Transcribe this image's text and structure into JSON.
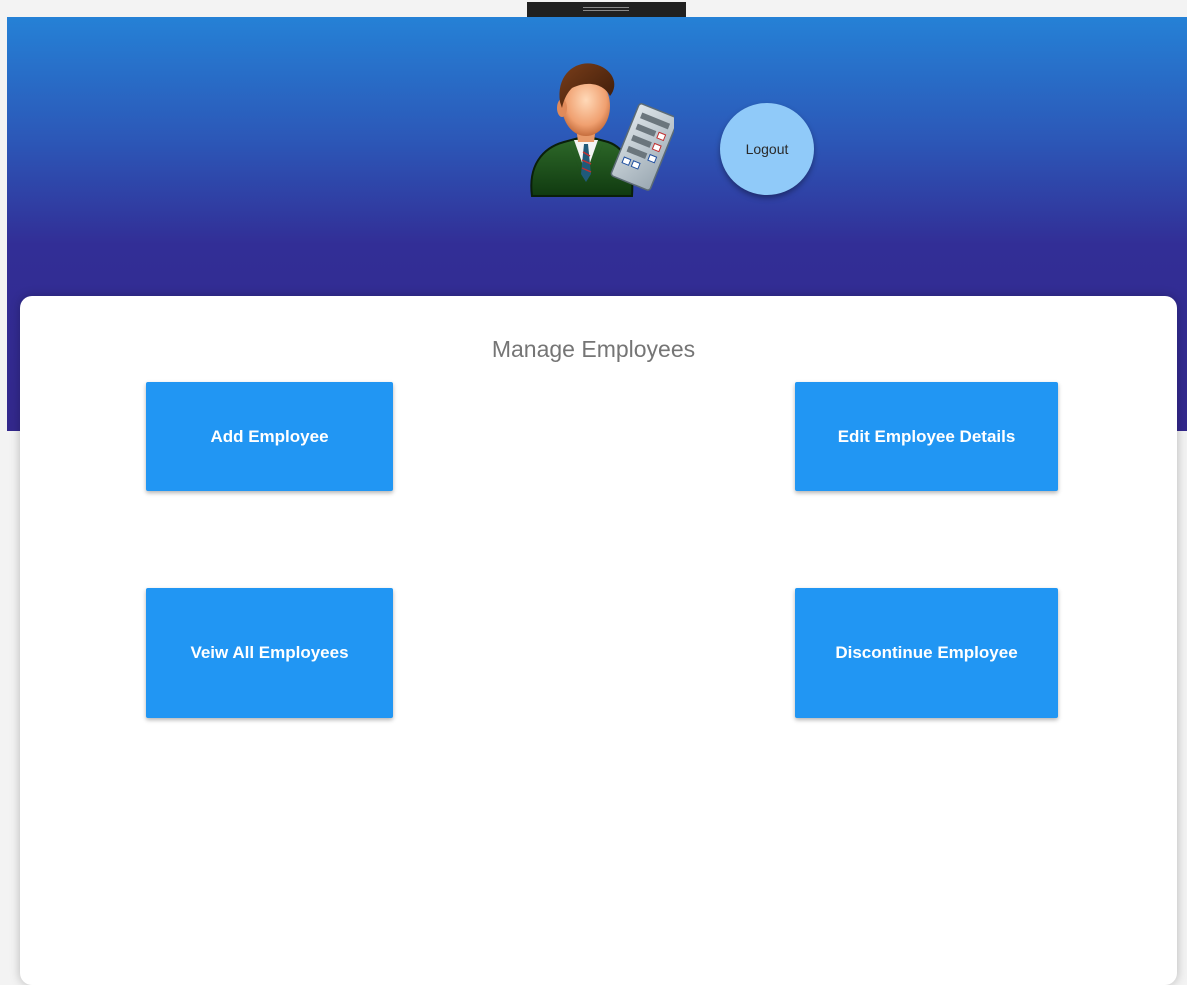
{
  "header": {
    "avatar_icon": "employee-manager-icon",
    "logout_label": "Logout"
  },
  "card": {
    "title": "Manage Employees",
    "buttons": {
      "add": "Add Employee",
      "edit": "Edit Employee Details",
      "view": "Veiw All Employees",
      "discontinue": "Discontinue Employee"
    }
  },
  "colors": {
    "header_top": "#2581d6",
    "header_bottom": "#33288c",
    "button_primary": "#2196f3",
    "logout_bg": "#90caf9",
    "title_text": "#757575"
  }
}
